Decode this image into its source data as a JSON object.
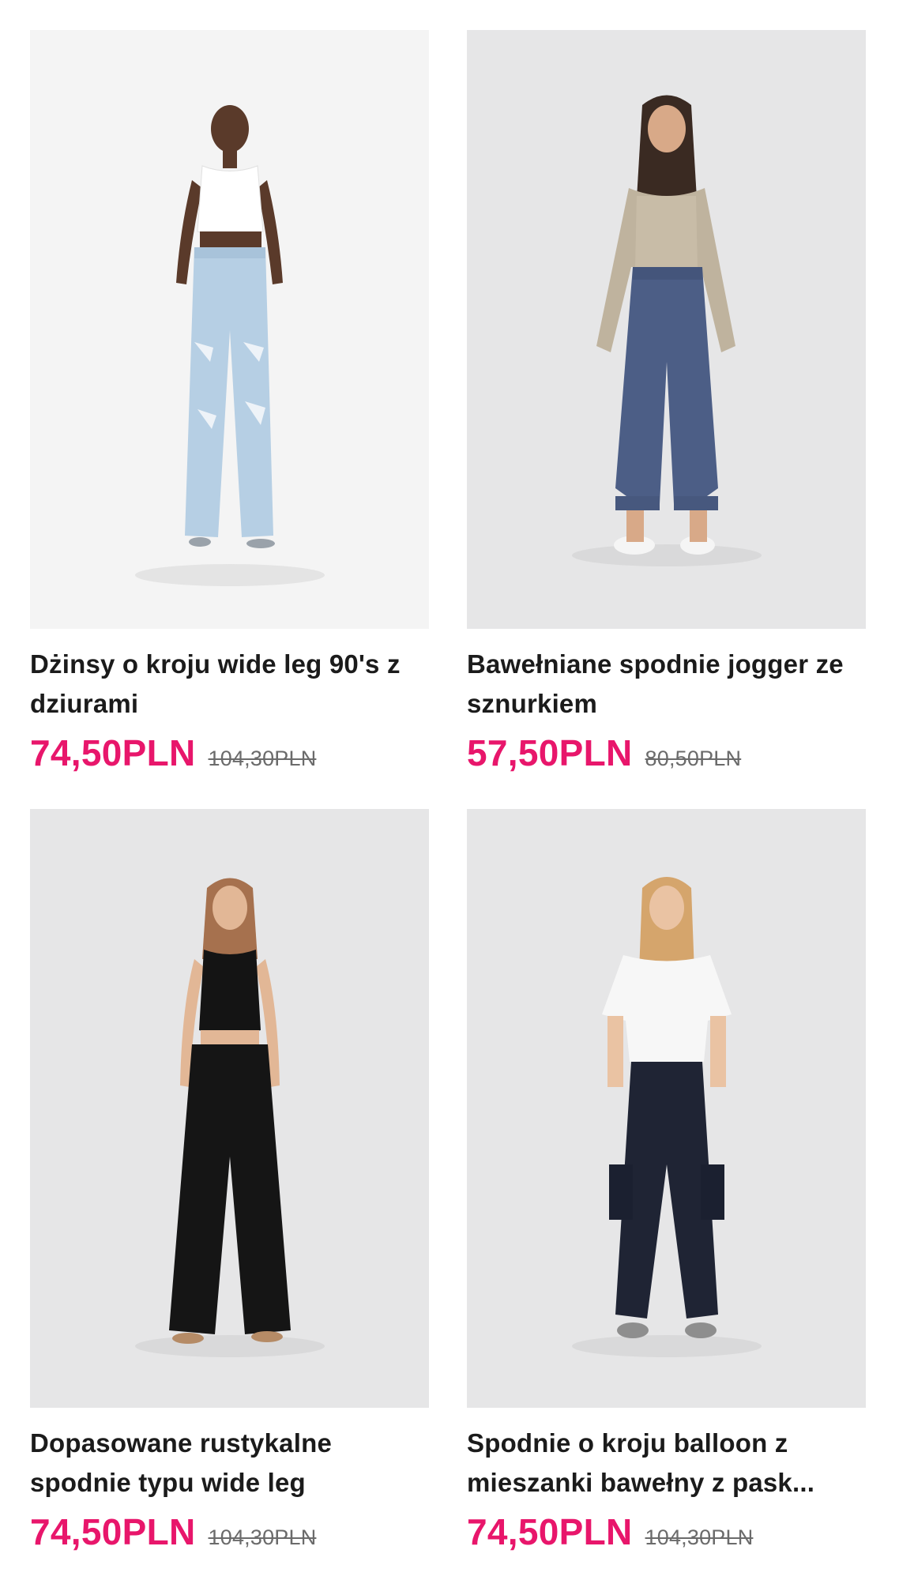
{
  "products": [
    {
      "title": "Dżinsy o kroju wide leg 90's z dziurami",
      "price": "74,50PLN",
      "old_price": "104,30PLN"
    },
    {
      "title": "Bawełniane spodnie jogger ze sznurkiem",
      "price": "57,50PLN",
      "old_price": "80,50PLN"
    },
    {
      "title": "Dopasowane rustykalne spodnie typu wide leg",
      "price": "74,50PLN",
      "old_price": "104,30PLN"
    },
    {
      "title": "Spodnie o kroju balloon z mieszanki bawełny z pask...",
      "price": "74,50PLN",
      "old_price": "104,30PLN"
    }
  ],
  "colors": {
    "sale_price": "#e8166b",
    "old_price": "#6b6b6b",
    "photo_background": "#e6e6e7"
  }
}
